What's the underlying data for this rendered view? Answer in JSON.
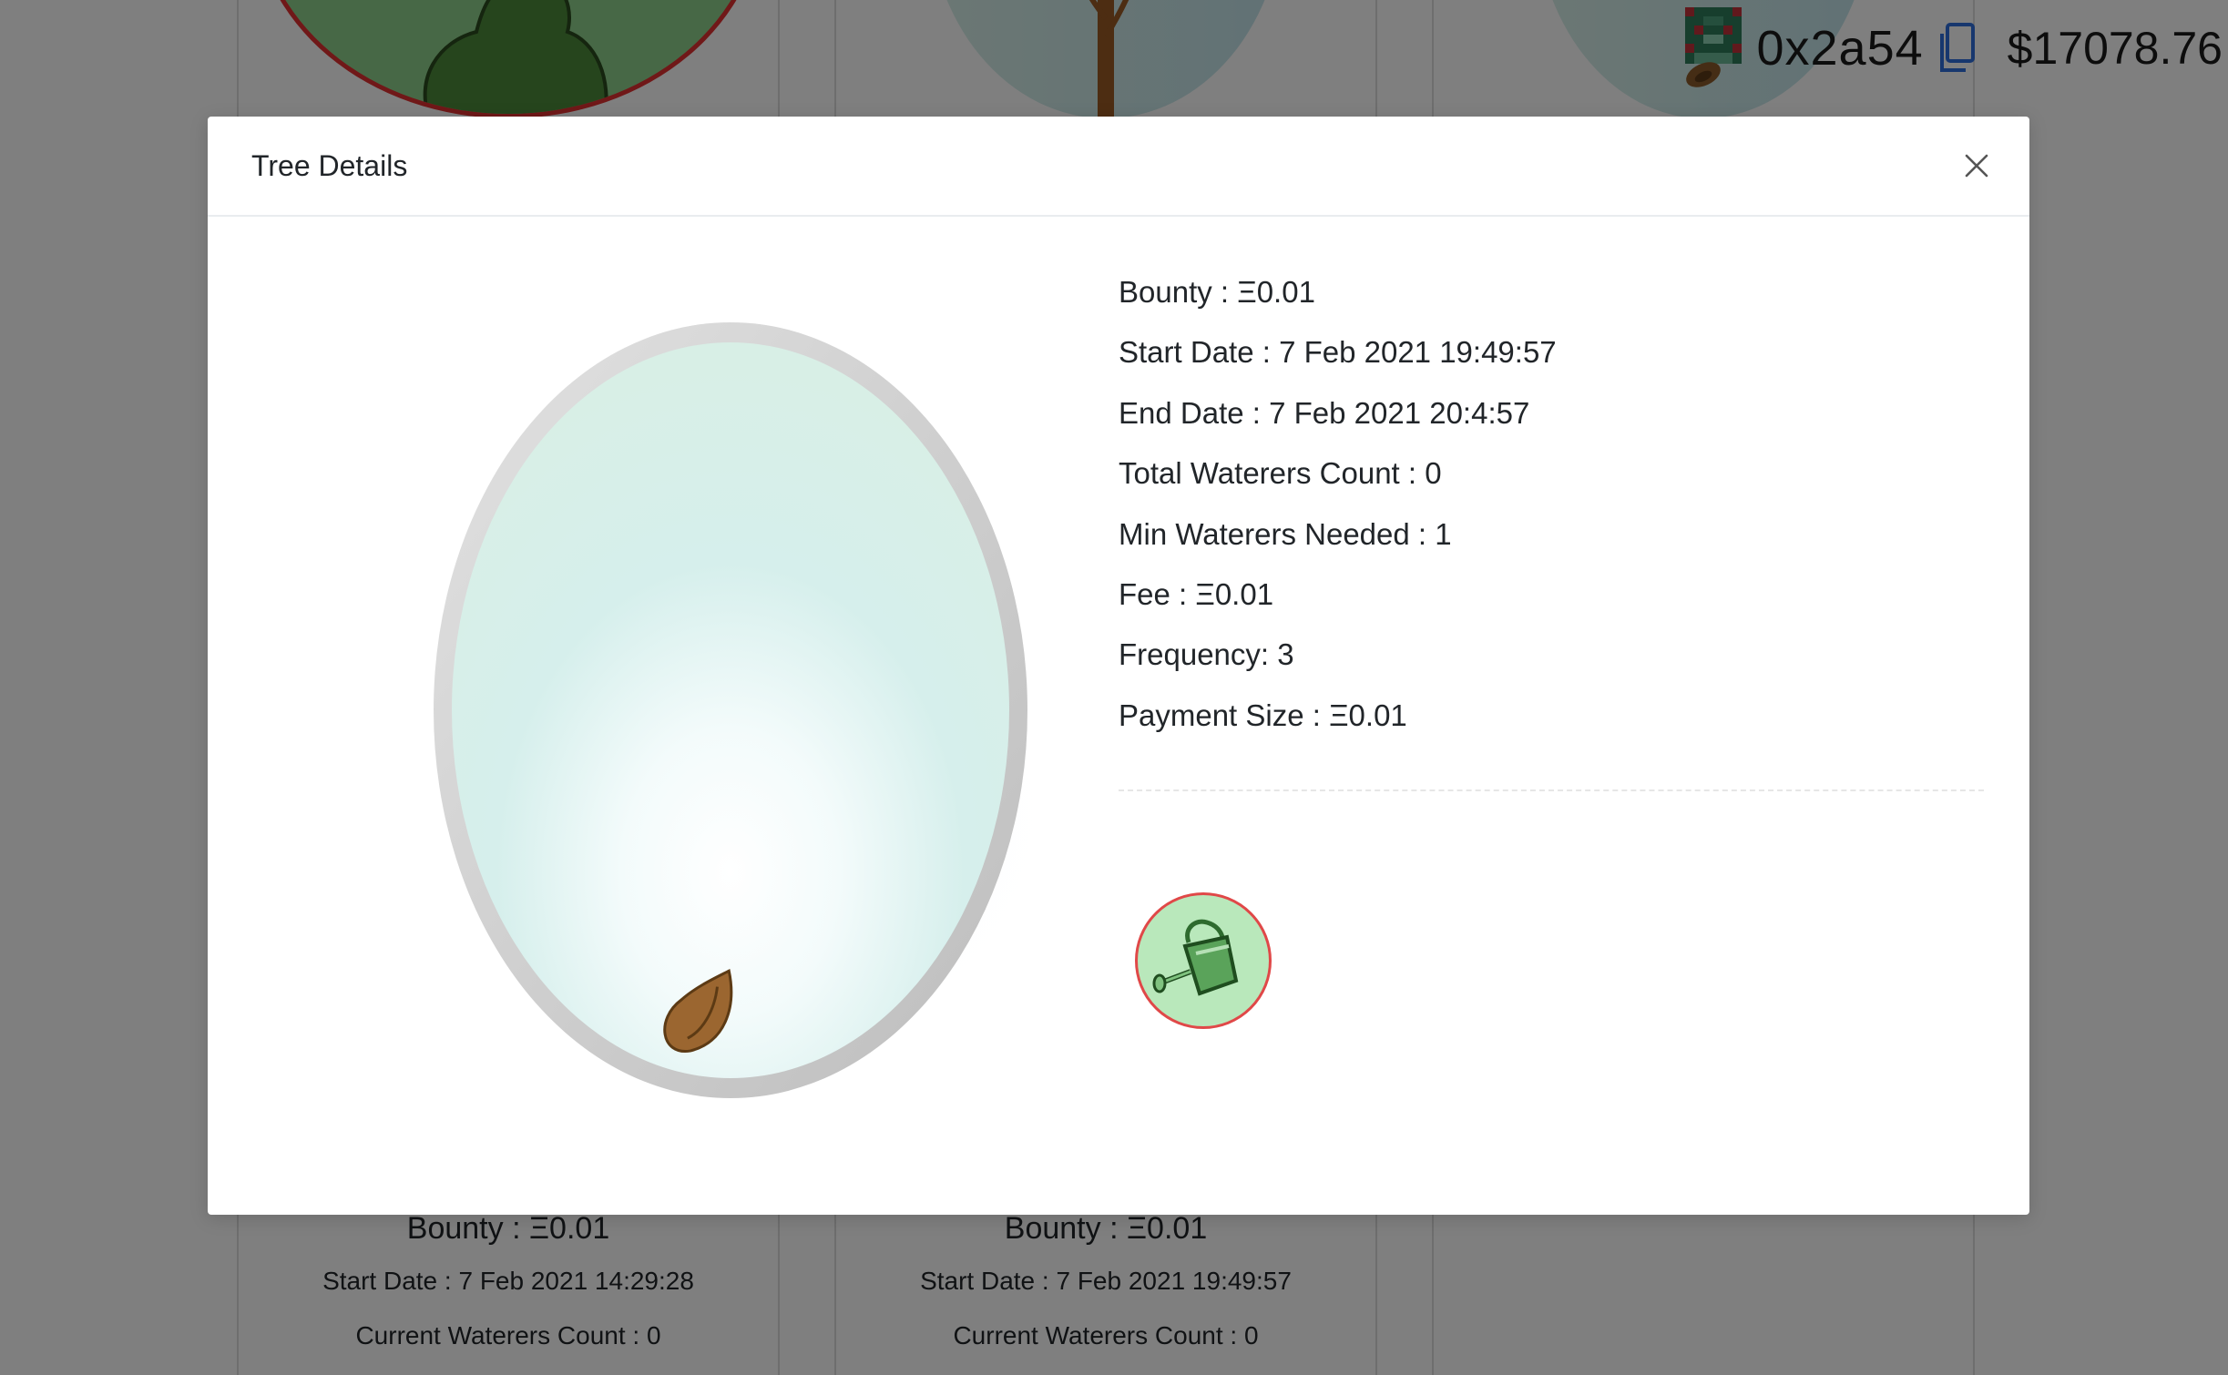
{
  "header": {
    "address": "0x2a54",
    "balance": "$17078.76"
  },
  "background_cards": [
    {
      "bounty": "Bounty : Ξ0.01",
      "start_date": "Start Date : 7 Feb 2021 14:29:28",
      "waterers": "Current Waterers Count : 0"
    },
    {
      "bounty": "Bounty : Ξ0.01",
      "start_date": "Start Date : 7 Feb 2021 19:49:57",
      "waterers": "Current Waterers Count : 0"
    }
  ],
  "modal": {
    "title": "Tree Details",
    "details": [
      "Bounty : Ξ0.01",
      "Start Date : 7 Feb 2021 19:49:57",
      "End Date : 7 Feb 2021 20:4:57",
      "Total Waterers Count : 0",
      "Min Waterers Needed : 1",
      "Fee : Ξ0.01",
      "Frequency: 3",
      "Payment Size : Ξ0.01"
    ]
  },
  "icons": {
    "close": "close-icon",
    "copy": "copy-icon",
    "seed": "seed-icon",
    "watering_can": "watering-can-icon",
    "avatar": "identicon-avatar"
  },
  "colors": {
    "backdrop": "#00000080",
    "water_button_bg": "#b9e8bb",
    "water_button_border": "#e04848",
    "copy_icon": "#2f6fdd",
    "card_circle_border": "#e03030"
  }
}
